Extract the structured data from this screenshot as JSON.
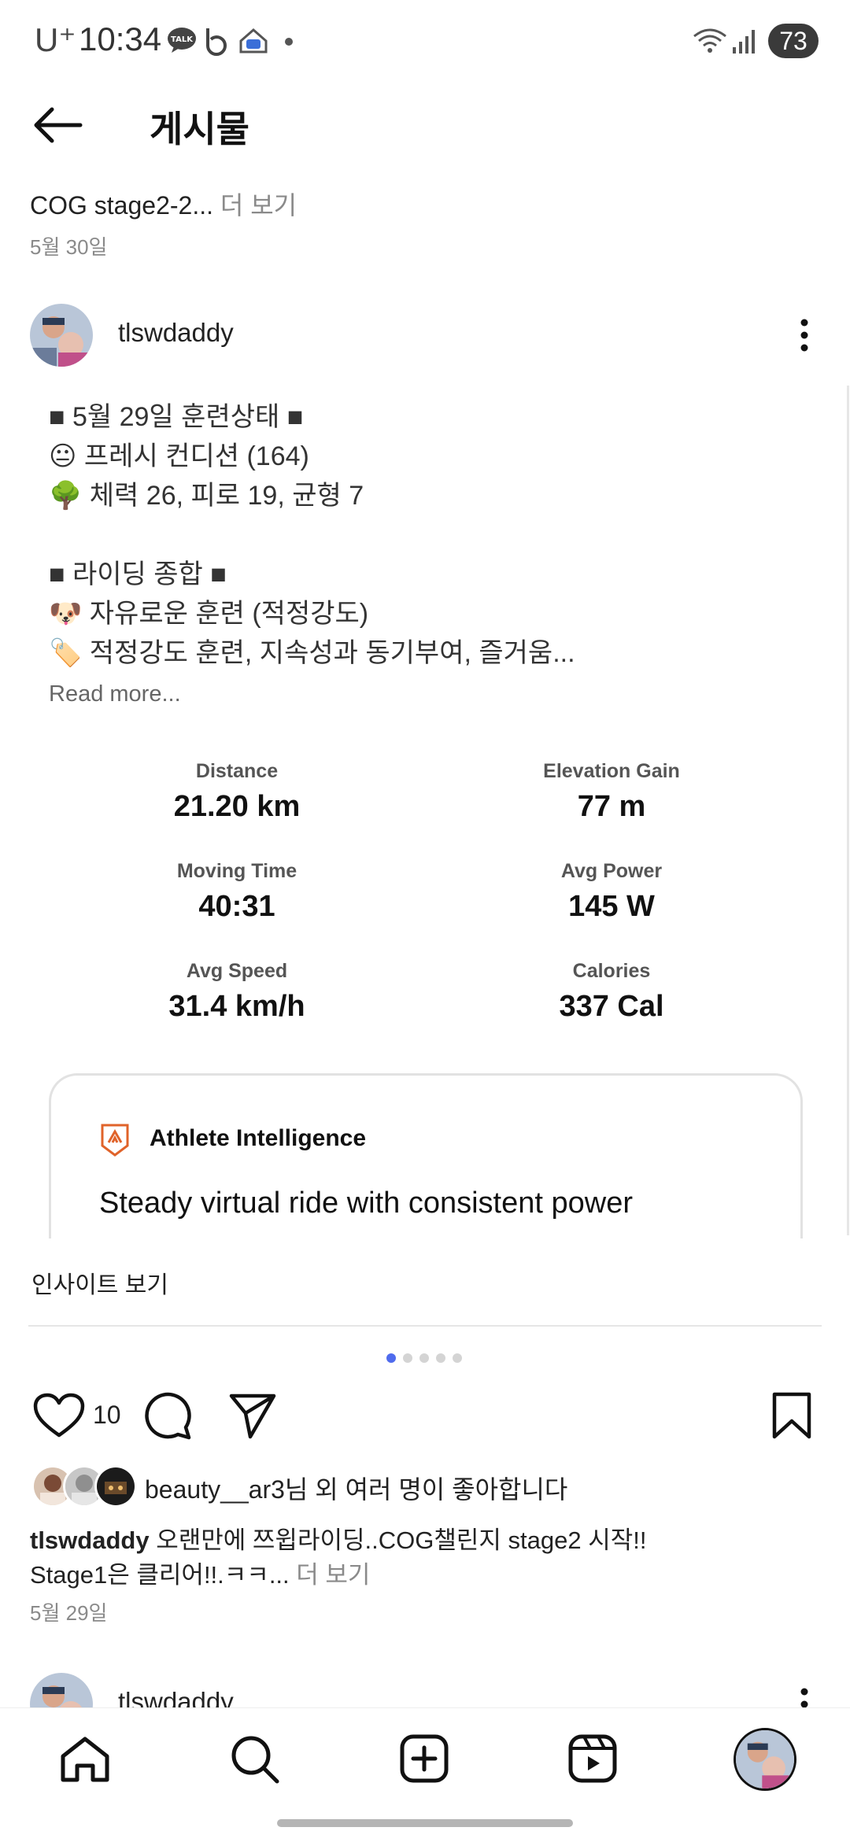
{
  "status_bar": {
    "carrier": "U⁺",
    "time": "10:34",
    "battery": "73"
  },
  "header": {
    "title": "게시물"
  },
  "previous_post": {
    "caption": "COG stage2-2...",
    "more": " 더 보기",
    "date": "5월 30일"
  },
  "post": {
    "username": "tlswdaddy",
    "lines": [
      "■ 5월 29일 훈련상태 ■",
      "😐 프레시 컨디션 (164)",
      "🌳 체력 26, 피로 19, 균형 7",
      "■ 라이딩 종합 ■",
      "🐶 자유로운 훈련 (적정강도)",
      "🏷️ 적정강도 훈련, 지속성과 동기부여, 즐거움..."
    ],
    "read_more": "Read more...",
    "stats": [
      {
        "label": "Distance",
        "value": "21.20 km"
      },
      {
        "label": "Elevation Gain",
        "value": "77 m"
      },
      {
        "label": "Moving Time",
        "value": "40:31"
      },
      {
        "label": "Avg Power",
        "value": "145 W"
      },
      {
        "label": "Avg Speed",
        "value": "31.4 km/h"
      },
      {
        "label": "Calories",
        "value": "337 Cal"
      }
    ],
    "ai_card": {
      "title": "Athlete Intelligence",
      "text": "Steady virtual ride with consistent power"
    },
    "insights_link": "인사이트 보기",
    "carousel": {
      "count": 5,
      "active": 1
    },
    "like_count": "10",
    "liked_by": "beauty__ar3님 외 여러 명이 좋아합니다",
    "caption_user": "tlswdaddy",
    "caption_line1": " 오랜만에 쯔윕라이딩..COG챌린지 stage2 시작!!",
    "caption_line2": "Stage1은 클리어!!.ㅋㅋ...",
    "caption_more": " 더 보기",
    "date": "5월 29일"
  },
  "next_post": {
    "username": "tlswdaddy"
  },
  "bottom_nav": [
    "home-icon",
    "search-icon",
    "create-icon",
    "reels-icon",
    "profile-avatar"
  ],
  "colors": {
    "accent_dot": "#4f6bed",
    "strava_orange": "#e0632a"
  }
}
